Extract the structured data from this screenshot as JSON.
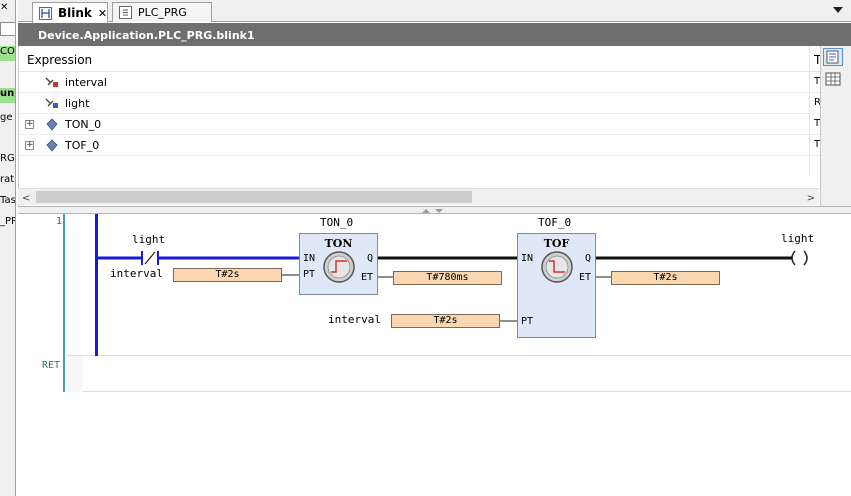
{
  "left_pane": {
    "fragment_1": "CO",
    "fragment_2": "un]",
    "fragment_3": "ge",
    "fragment_4": "RG)",
    "fragment_5": "rat",
    "fragment_6": "Tas",
    "fragment_7": "_PR"
  },
  "tabs": [
    {
      "label": "Blink",
      "close": "✕",
      "active": true
    },
    {
      "label": "PLC_PRG",
      "active": false
    }
  ],
  "header": {
    "title": "Device.Application.PLC_PRG.blink1"
  },
  "watch": {
    "columns": {
      "expression": "Expression",
      "type": "T"
    },
    "rows": [
      {
        "name": "interval",
        "type": "T",
        "icon": "input-variable-icon",
        "expandable": false
      },
      {
        "name": "light",
        "type": "R",
        "icon": "output-variable-icon",
        "expandable": false
      },
      {
        "name": "TON_0",
        "type": "T",
        "icon": "instance-icon",
        "expandable": true
      },
      {
        "name": "TOF_0",
        "type": "T",
        "icon": "instance-icon",
        "expandable": true
      }
    ],
    "expand_glyph": "+"
  },
  "scroll": {
    "left": "<",
    "right": ">"
  },
  "ladder": {
    "network_number": "1",
    "ret_label": "RET",
    "contact": {
      "variable": "light",
      "negated": true
    },
    "ton": {
      "instance": "TON_0",
      "type": "TON",
      "pins_in": [
        "IN",
        "PT"
      ],
      "pins_out": [
        "Q",
        "ET"
      ],
      "pt_variable": "interval",
      "pt_value": "T#2s",
      "et_value": "T#780ms"
    },
    "tof": {
      "instance": "TOF_0",
      "type": "TOF",
      "pins_in": [
        "IN",
        "PT"
      ],
      "pins_out": [
        "Q",
        "ET"
      ],
      "pt_variable": "interval",
      "pt_value": "T#2s",
      "et_value": "T#2s"
    },
    "coil": {
      "variable": "light"
    }
  }
}
